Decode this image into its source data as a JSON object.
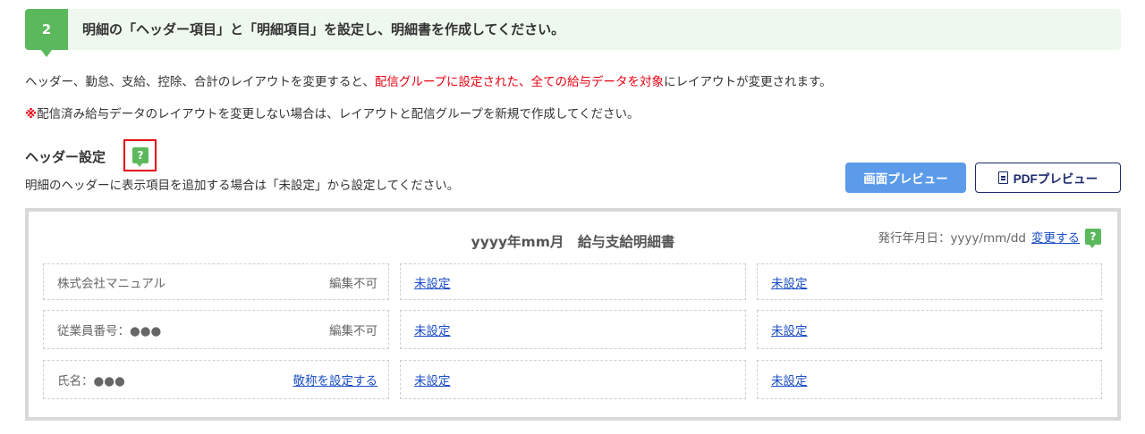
{
  "step": {
    "number": "2",
    "title": "明細の「ヘッダー項目」と「明細項目」を設定し、明細書を作成してください。"
  },
  "notice": {
    "line1_before": "ヘッダー、勤怠、支給、控除、合計のレイアウトを変更すると、",
    "line1_highlight": "配信グループに設定された、全ての給与データを対象",
    "line1_after": "にレイアウトが変更されます。",
    "line2_mark": "※",
    "line2_text": "配信済み給与データのレイアウトを変更しない場合は、レイアウトと配信グループを新規で作成してください。"
  },
  "header_section": {
    "title": "ヘッダー設定",
    "help_label": "?",
    "subtitle": "明細のヘッダーに表示項目を追加する場合は「未設定」から設定してください。"
  },
  "buttons": {
    "screen_preview": "画面プレビュー",
    "pdf_preview": "PDFプレビュー"
  },
  "preview": {
    "title": "yyyy年mm月　給与支給明細書",
    "issue_date_label": "発行年月日：yyyy/mm/dd",
    "change_link": "変更する",
    "help_label": "?",
    "rows": [
      {
        "left_label": "株式会社マニュアル",
        "left_note": "編集不可",
        "middle": "未設定",
        "right": "未設定"
      },
      {
        "left_label": "従業員番号：●●●",
        "left_note": "編集不可",
        "middle": "未設定",
        "right": "未設定"
      },
      {
        "left_label": "氏名：●●●",
        "left_link": "敬称を設定する",
        "middle": "未設定",
        "right": "未設定"
      }
    ]
  },
  "colors": {
    "accent_green": "#5cb85c",
    "highlight_red": "#e60012",
    "preview_button_blue": "#5b9bea",
    "link_blue": "#1a4dc6"
  }
}
